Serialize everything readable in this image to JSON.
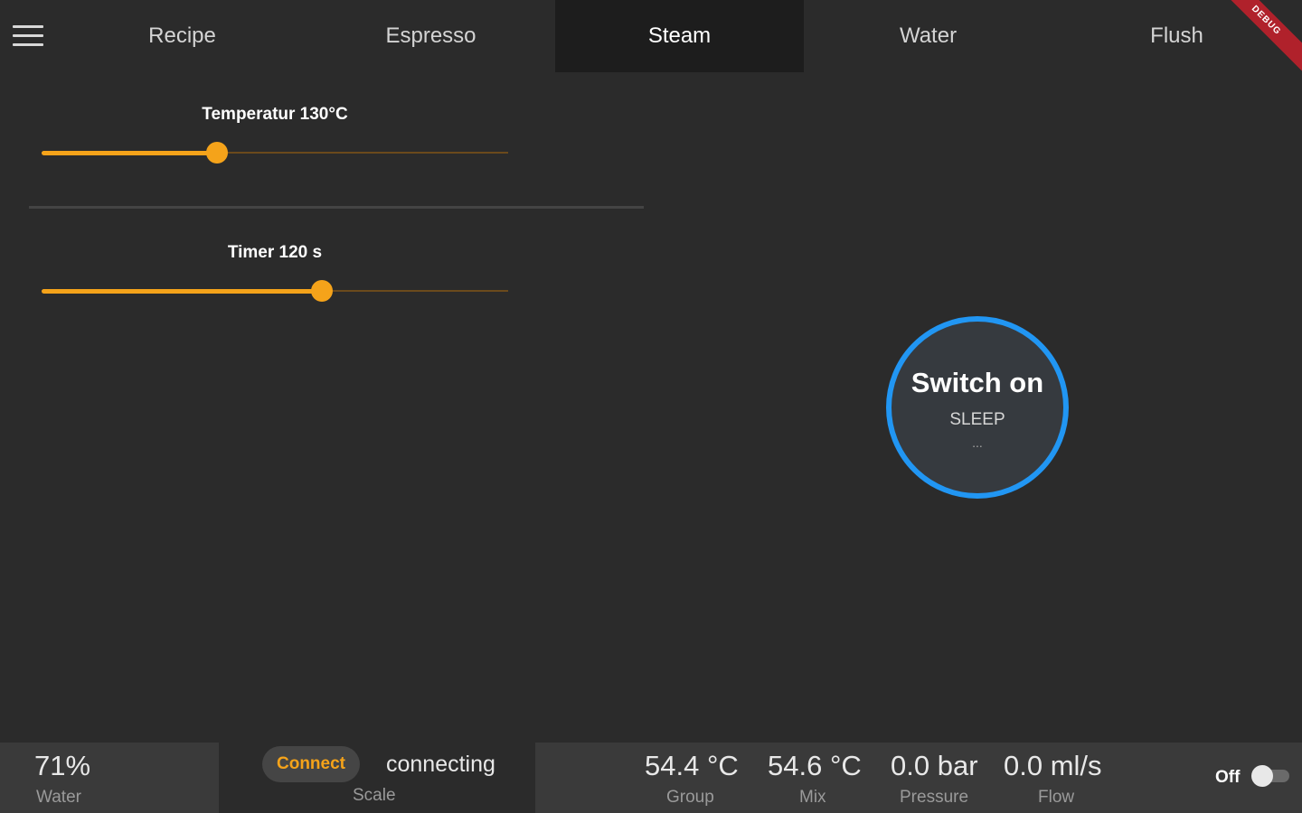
{
  "nav": {
    "menu_icon": "hamburger-menu-icon",
    "tabs": [
      {
        "label": "Recipe"
      },
      {
        "label": "Espresso"
      },
      {
        "label": "Steam",
        "active": true
      },
      {
        "label": "Water"
      },
      {
        "label": "Flush"
      }
    ],
    "banner_text": "DEBUG"
  },
  "steam": {
    "temperature": {
      "label": "Temperatur 130°C",
      "value": 130,
      "fill_fraction": 0.375
    },
    "timer": {
      "label": "Timer 120 s",
      "value": 120,
      "fill_fraction": 0.6
    }
  },
  "power": {
    "title": "Switch on",
    "state": "SLEEP",
    "sub": "..."
  },
  "status": {
    "water": {
      "value": "71%",
      "label": "Water"
    },
    "scale": {
      "button": "Connect",
      "status": "connecting",
      "label": "Scale"
    },
    "group": {
      "value": "54.4 °C",
      "label": "Group"
    },
    "mix": {
      "value": "54.6 °C",
      "label": "Mix"
    },
    "pressure": {
      "value": "0.0 bar",
      "label": "Pressure"
    },
    "flow": {
      "value": "0.0 ml/s",
      "label": "Flow"
    },
    "toggle": {
      "label": "Off",
      "on": false
    }
  },
  "colors": {
    "accent": "#f5a31a",
    "power_ring": "#2196f3",
    "background": "#2b2b2b"
  }
}
